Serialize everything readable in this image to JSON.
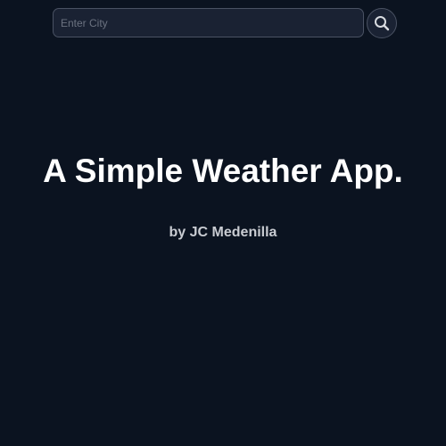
{
  "search": {
    "placeholder": "Enter City",
    "value": "",
    "button_icon": "search-icon"
  },
  "main": {
    "title": "A Simple Weather App.",
    "author": "by JC Medenilla"
  },
  "colors": {
    "background": "#0b1320",
    "input_background": "#1a2233",
    "border": "#4a5263",
    "title_text": "#ffffff",
    "subtitle_text": "#c9ccd2"
  }
}
